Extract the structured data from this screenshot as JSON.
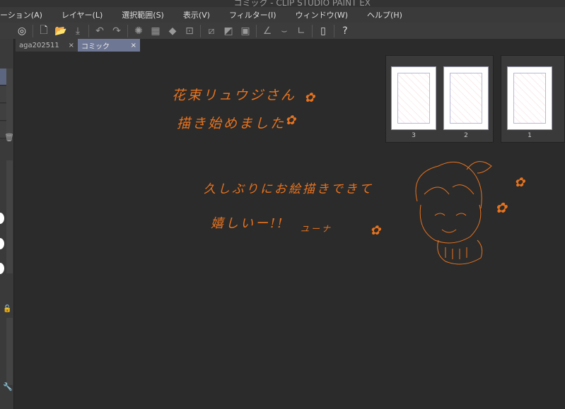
{
  "window": {
    "title": "コミック - CLIP STUDIO PAINT EX"
  },
  "menu": [
    "ーション(A)",
    "レイヤー(L)",
    "選択範囲(S)",
    "表示(V)",
    "フィルター(I)",
    "ウィンドウ(W)",
    "ヘルプ(H)"
  ],
  "tabs": [
    {
      "label": "aga202511",
      "close": "×"
    },
    {
      "label": "コミック",
      "close": "×"
    }
  ],
  "canvas_text": {
    "line1": "花束リュウジさん",
    "line2": "描き始めました",
    "line3": "久しぶりにお絵描きできて",
    "line4": "嬉しいー!!",
    "signature": "ユーナ"
  },
  "pages": [
    "3",
    "2",
    "1"
  ],
  "colors": {
    "accent": "#e8731e",
    "tab_active": "#6e7895"
  }
}
